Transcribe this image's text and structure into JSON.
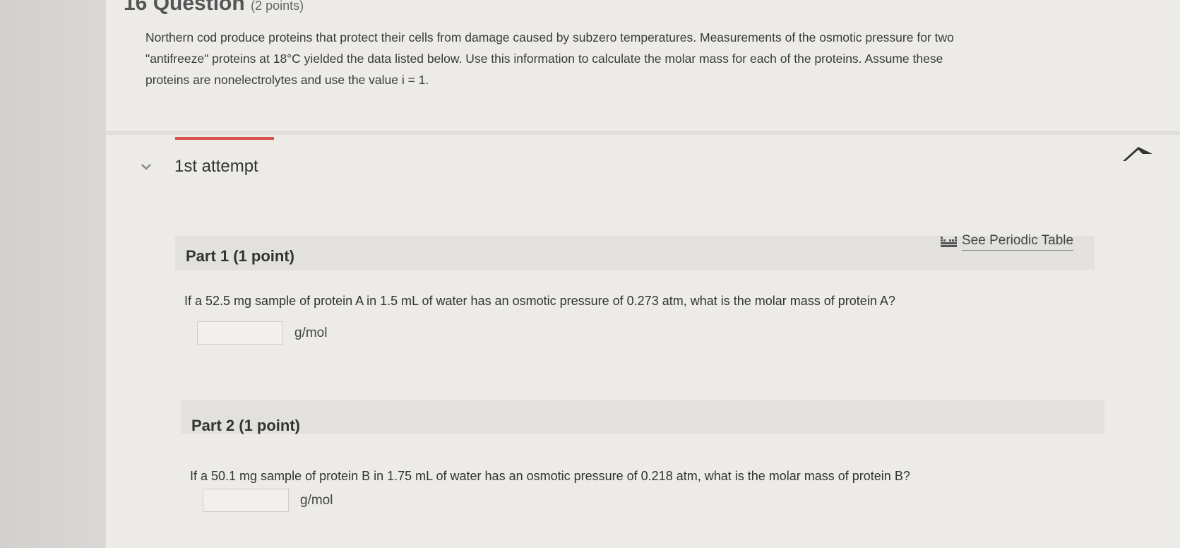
{
  "question": {
    "header": "16 Question",
    "points": "(2 points)",
    "prompt_line1": "Northern cod produce proteins that protect their cells from damage caused by subzero temperatures. Measurements of the osmotic pressure for two",
    "prompt_line2": "\"antifreeze\" proteins at 18°C yielded the data listed below. Use this information to calculate the molar mass for each of the proteins. Assume these",
    "prompt_line3": "proteins are nonelectrolytes and use the value i = 1."
  },
  "attempt": {
    "title": "1st attempt"
  },
  "periodic_table": {
    "label": "See Periodic Table"
  },
  "parts": [
    {
      "title": "Part 1   (1 point)",
      "question": "If a 52.5  mg sample of protein A in 1.5 mL of water has an osmotic pressure of 0.273  atm, what is the molar mass of protein A?",
      "answer": "",
      "unit": "g/mol"
    },
    {
      "title": "Part 2   (1 point)",
      "question": "If a 50.1  mg sample of protein B in 1.75 mL of water has an osmotic pressure of 0.218 atm, what is the molar mass of protein B?",
      "answer": "",
      "unit": "g/mol"
    }
  ],
  "colors": {
    "accent": "#d9534f",
    "page_bg": "#ecebe8"
  }
}
